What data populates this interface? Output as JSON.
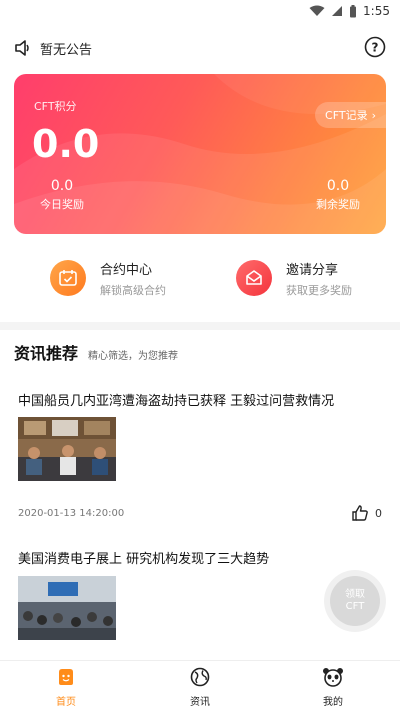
{
  "status_bar": {
    "time": "1:55"
  },
  "announcement": {
    "text": "暂无公告",
    "icon": "speaker-icon",
    "help_icon": "help-icon"
  },
  "points_card": {
    "label": "CFT积分",
    "value": "0.0",
    "records_label": "CFT记录",
    "today": {
      "value": "0.0",
      "label": "今日奖励"
    },
    "remaining": {
      "value": "0.0",
      "label": "剩余奖励"
    },
    "colors": {
      "start": "#ff3e6c",
      "end": "#ffa238"
    }
  },
  "features": [
    {
      "title": "合约中心",
      "subtitle": "解锁高级合约",
      "icon": "calendar-check-icon",
      "color": "#ff8a2a"
    },
    {
      "title": "邀请分享",
      "subtitle": "获取更多奖励",
      "icon": "envelope-icon",
      "color": "#f4343d"
    }
  ],
  "news": {
    "title": "资讯推荐",
    "subtitle": "精心筛选，为您推荐",
    "articles": [
      {
        "title": "中国船员几内亚湾遭海盗劫持已获释 王毅过问营救情况",
        "date": "2020-01-13 14:20:00",
        "likes": "0"
      },
      {
        "title": "美国消费电子展上 研究机构发现了三大趋势"
      }
    ]
  },
  "claim_button": {
    "label": "领取CFT"
  },
  "tabs": [
    {
      "label": "首页",
      "icon": "home-icon",
      "active": true
    },
    {
      "label": "资讯",
      "icon": "globe-icon",
      "active": false
    },
    {
      "label": "我的",
      "icon": "panda-icon",
      "active": false
    }
  ],
  "colors": {
    "accent": "#ff8c1a",
    "tab_inactive": "#222222"
  }
}
